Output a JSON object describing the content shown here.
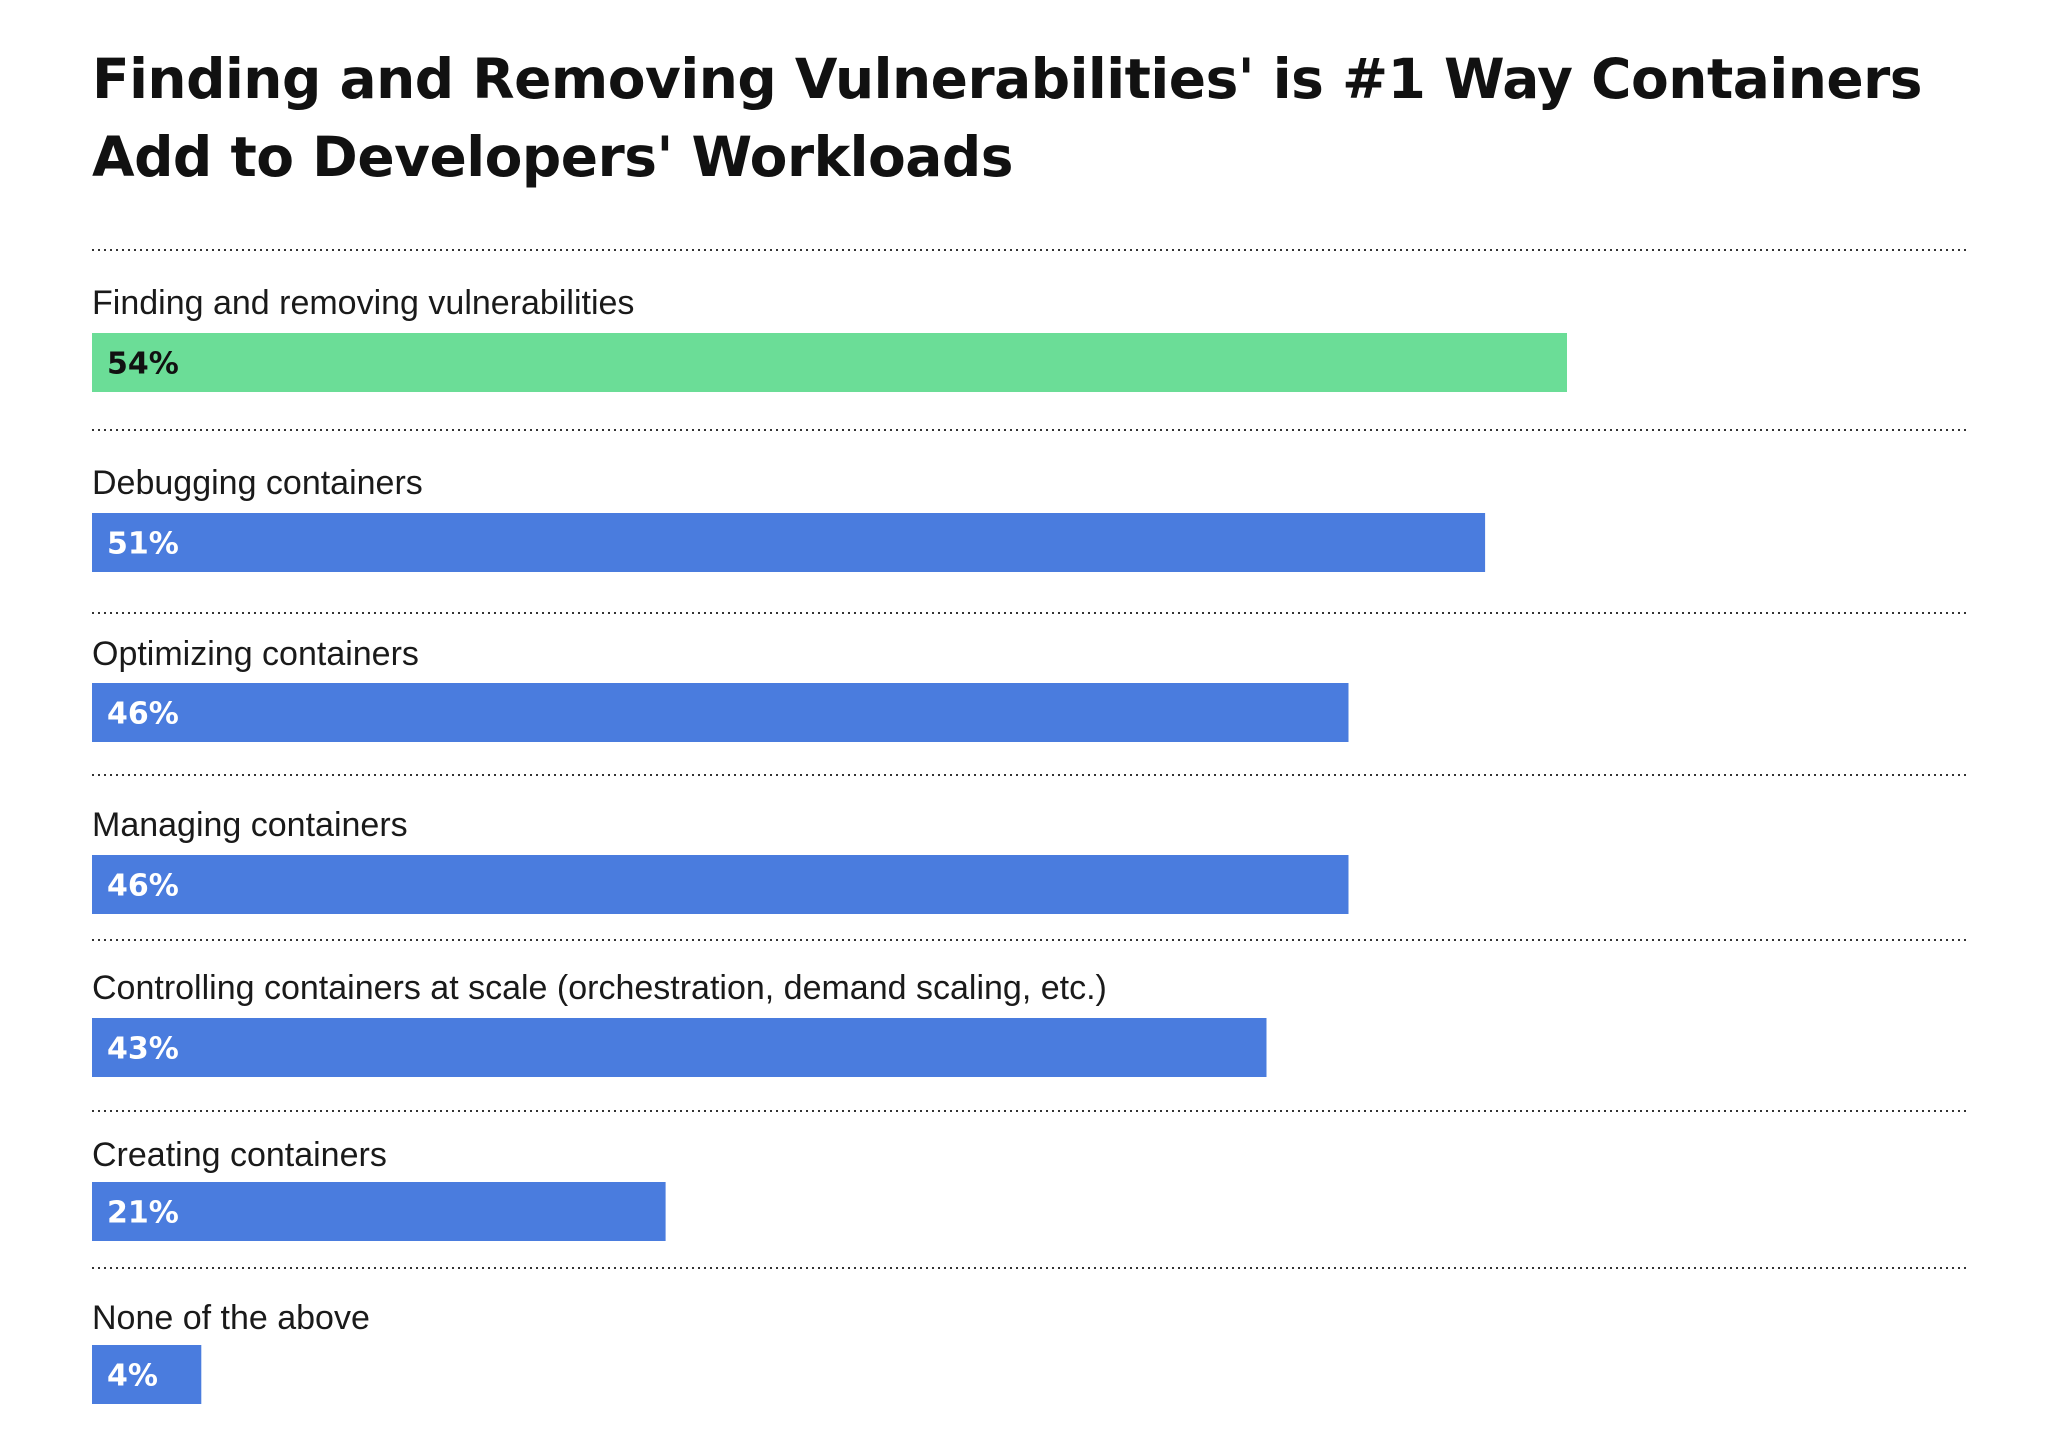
{
  "title": "Finding and Removing Vulnerabilities' is #1 Way Containers Add to Developers' Workloads",
  "chart_data": {
    "type": "bar",
    "orientation": "horizontal",
    "title": "Finding and Removing Vulnerabilities' is #1 Way Containers Add to Developers' Workloads",
    "xlabel": "",
    "ylabel": "",
    "xlim": [
      0,
      71
    ],
    "grid": false,
    "categories": [
      "Finding and removing vulnerabilities",
      "Debugging containers",
      "Optimizing containers",
      "Managing containers",
      "Controlling containers at scale (orchestration, demand scaling, etc.)",
      "Creating containers",
      "None of the above"
    ],
    "values": [
      54,
      51,
      46,
      46,
      43,
      21,
      4
    ],
    "value_labels": [
      "54%",
      "51%",
      "46%",
      "46%",
      "43%",
      "21%",
      "4%"
    ],
    "colors": {
      "highlight_bar": "#6BDD97",
      "bar": "#4A7CDE",
      "highlight_label": "#111111",
      "label": "#FFFFFF",
      "separator": "#333333"
    },
    "highlight_index": 0
  }
}
